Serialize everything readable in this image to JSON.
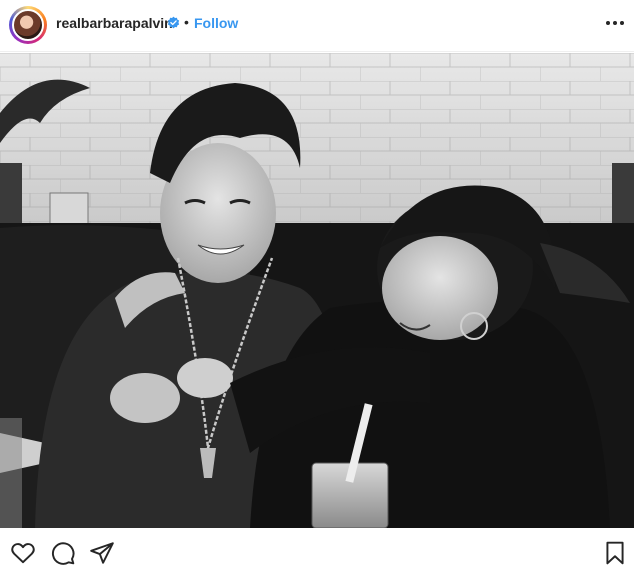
{
  "header": {
    "username": "realbarbarapalvin",
    "separator": "•",
    "follow_label": "Follow",
    "icons": [
      "avatar",
      "verified-badge-icon",
      "more-options-icon"
    ],
    "colors": {
      "follow": "#3897f0",
      "verified": "#3897f0",
      "text": "#262626"
    }
  },
  "photo": {
    "alt": "Black and white photo"
  },
  "actions": {
    "icons": [
      "heart-icon",
      "comment-icon",
      "share-icon",
      "bookmark-icon"
    ]
  }
}
